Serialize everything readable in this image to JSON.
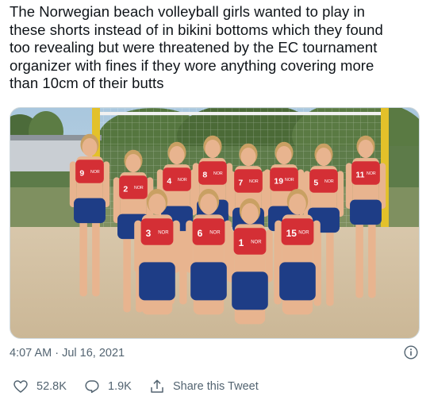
{
  "tweet": {
    "lines": [
      "The Norwegian beach volleyball girls wanted to play in",
      "these shorts instead of in bikini bottoms which they found",
      "too revealing but were threatened by the EC tournament",
      "organizer with fines if they wore anything covering more",
      "than 10cm of their butts"
    ],
    "timestamp": "4:07 AM · Jul 16, 2021"
  },
  "media": {
    "jersey_text": "NOR",
    "jersey_numbers_back": [
      "9",
      "2",
      "4",
      "8",
      "7",
      "19",
      "5",
      "11"
    ],
    "jersey_numbers_front": [
      "3",
      "6",
      "1",
      "15"
    ],
    "colors": {
      "jersey": "#d42f35",
      "shorts": "#1e3d86",
      "sand": "#d9c7a9",
      "net_post": "#e3c12a"
    }
  },
  "actions": {
    "likes": "52.8K",
    "retweets": "1.9K",
    "share_label": "Share this Tweet"
  },
  "icons": [
    "heart-icon",
    "reply-icon",
    "share-icon",
    "info-icon"
  ]
}
